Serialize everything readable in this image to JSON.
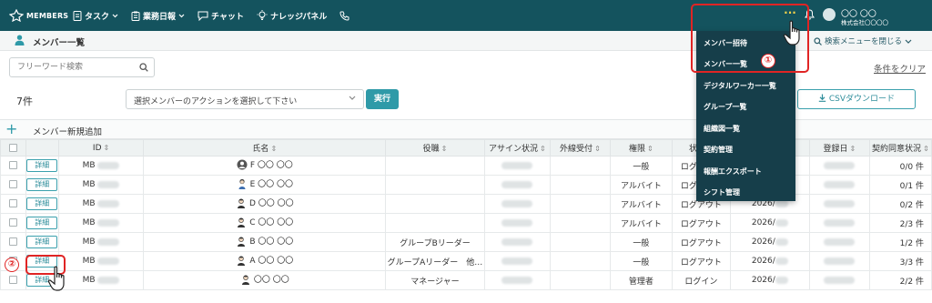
{
  "app": {
    "logo_text": "MEMBERS"
  },
  "nav": [
    {
      "label": "タスク",
      "icon": "document-icon",
      "has_dropdown": true
    },
    {
      "label": "業務日報",
      "icon": "clipboard-icon",
      "has_dropdown": true
    },
    {
      "label": "チャット",
      "icon": "chat-icon",
      "has_dropdown": false
    },
    {
      "label": "ナレッジパネル",
      "icon": "lightbulb-icon",
      "has_dropdown": false
    },
    {
      "label": "",
      "icon": "phone-icon",
      "has_dropdown": false
    }
  ],
  "header": {
    "more_label": "···",
    "user_name": "〇〇 〇〇",
    "company": "株式会社〇〇〇〇"
  },
  "page": {
    "title": "メンバー一覧",
    "search_toggle": "検索メニューを閉じる"
  },
  "search": {
    "placeholder": "フリーワード検索",
    "clear_label": "条件をクリア"
  },
  "list": {
    "count": "7件",
    "action_placeholder": "選択メンバーのアクションを選択して下さい",
    "execute_label": "実行",
    "csv_label": "CSVダウンロード",
    "add_label": "メンバー新規追加"
  },
  "table": {
    "headers": [
      "",
      "",
      "ID",
      "氏名",
      "役職",
      "アサイン状況",
      "外線受付",
      "権限",
      "状態",
      "",
      "登録日",
      "契約同意状況"
    ],
    "detail_label": "詳細",
    "rows": [
      {
        "id": "MB",
        "name": "F 〇〇 〇〇",
        "position": "",
        "role": "一般",
        "status": "ログアウト",
        "date": "",
        "consent": "0/0 件",
        "avatar": "circle"
      },
      {
        "id": "MB",
        "name": "E 〇〇 〇〇",
        "position": "",
        "role": "アルバイト",
        "status": "ログアウト",
        "date": "",
        "consent": "0/1 件",
        "avatar": "woman"
      },
      {
        "id": "MB",
        "name": "D 〇〇 〇〇",
        "position": "",
        "role": "アルバイト",
        "status": "ログアウト",
        "date": "2026/",
        "consent": "0/2 件",
        "avatar": "man"
      },
      {
        "id": "MB",
        "name": "C 〇〇 〇〇",
        "position": "",
        "role": "アルバイト",
        "status": "ログアウト",
        "date": "2026/",
        "consent": "2/3 件",
        "avatar": "man"
      },
      {
        "id": "MB",
        "name": "B 〇〇 〇〇",
        "position": "グループBリーダー",
        "role": "一般",
        "status": "ログアウト",
        "date": "2026/",
        "consent": "1/2 件",
        "avatar": "man"
      },
      {
        "id": "MB",
        "name": "A 〇〇 〇〇",
        "position": "グループAリーダー　他…",
        "role": "一般",
        "status": "ログアウト",
        "date": "2026/",
        "consent": "3/3 件",
        "avatar": "man"
      },
      {
        "id": "MB",
        "name": "〇〇 〇〇",
        "position": "マネージャー",
        "role": "管理者",
        "status": "ログイン",
        "date": "2026/",
        "consent": "2/2 件",
        "avatar": "man"
      }
    ]
  },
  "menu": {
    "items": [
      "メンバー招待",
      "メンバー一覧",
      "デジタルワーカー一覧",
      "グループ一覧",
      "組織図一覧",
      "契約管理",
      "報酬エクスポート",
      "シフト管理"
    ]
  },
  "annotations": {
    "one": "①",
    "two": "②"
  },
  "colors": {
    "nav_bg": "#14535e",
    "accent": "#2f9aa8",
    "menu_bg": "#163e4a",
    "annotation": "#e02424"
  }
}
